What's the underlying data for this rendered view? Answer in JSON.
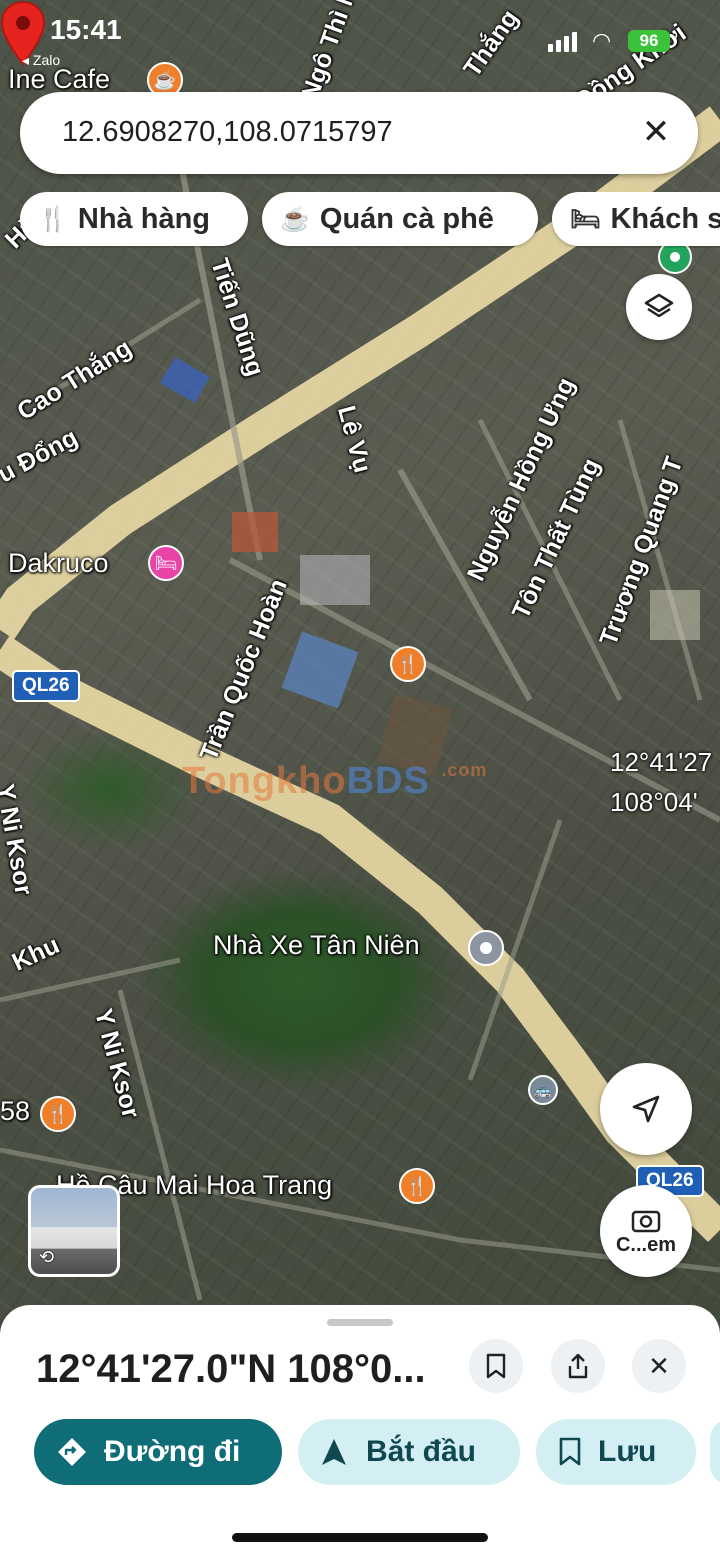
{
  "status_bar": {
    "time": "15:41",
    "back_app": "◂ Zalo",
    "battery": "96"
  },
  "search": {
    "query": "12.6908270,108.0715797"
  },
  "chips": [
    {
      "icon": "fork-knife-icon",
      "label": "Nhà hàng"
    },
    {
      "icon": "coffee-cup-icon",
      "label": "Quán cà phê"
    },
    {
      "icon": "bed-icon",
      "label": "Khách s"
    }
  ],
  "map": {
    "streets": [
      "Ngô Thì N",
      "Đồng Khởi",
      "Tiến Dũng",
      "Cao Thắng",
      "u Đổng",
      "Lê Vụ",
      "Nguyễn Hồng Ưng",
      "Tôn Thất Tùng",
      "Trương Quang T",
      "Trần Quốc Hoàn",
      "Y Ni Ksor",
      "Y Ni Ksor",
      "Khu",
      "Thắng",
      "Hù"
    ],
    "route_badges": [
      "QL26",
      "QL26"
    ],
    "pois": [
      {
        "label": "Ine Cafe",
        "icon": "coffee-icon"
      },
      {
        "label": "Dakruco",
        "icon": "hotel-icon"
      },
      {
        "label": "Nhà Xe Tân Niên",
        "icon": "bus-station-icon"
      },
      {
        "label": "Hồ Câu Mai Hoa Trang",
        "icon": "restaurant-icon"
      },
      {
        "label": "58",
        "icon": "restaurant-icon"
      }
    ],
    "dropped_pin": {
      "lat_label": "12°41'27",
      "lng_label": "108°04'"
    },
    "watermark": {
      "part1": "Tongkho",
      "part2": "BDS",
      "suffix": ".com"
    }
  },
  "controls": {
    "camera_label": "C...em"
  },
  "sheet": {
    "title": "12°41'27.0\"N 108°0...",
    "actions": [
      {
        "icon": "directions-icon",
        "label": "Đường đi"
      },
      {
        "icon": "navigation-arrow-icon",
        "label": "Bắt đầu"
      },
      {
        "icon": "bookmark-icon",
        "label": "Lưu"
      }
    ]
  },
  "colors": {
    "primary": "#0f6d78",
    "secondary": "#d3eff4",
    "pin": "#e52420"
  }
}
